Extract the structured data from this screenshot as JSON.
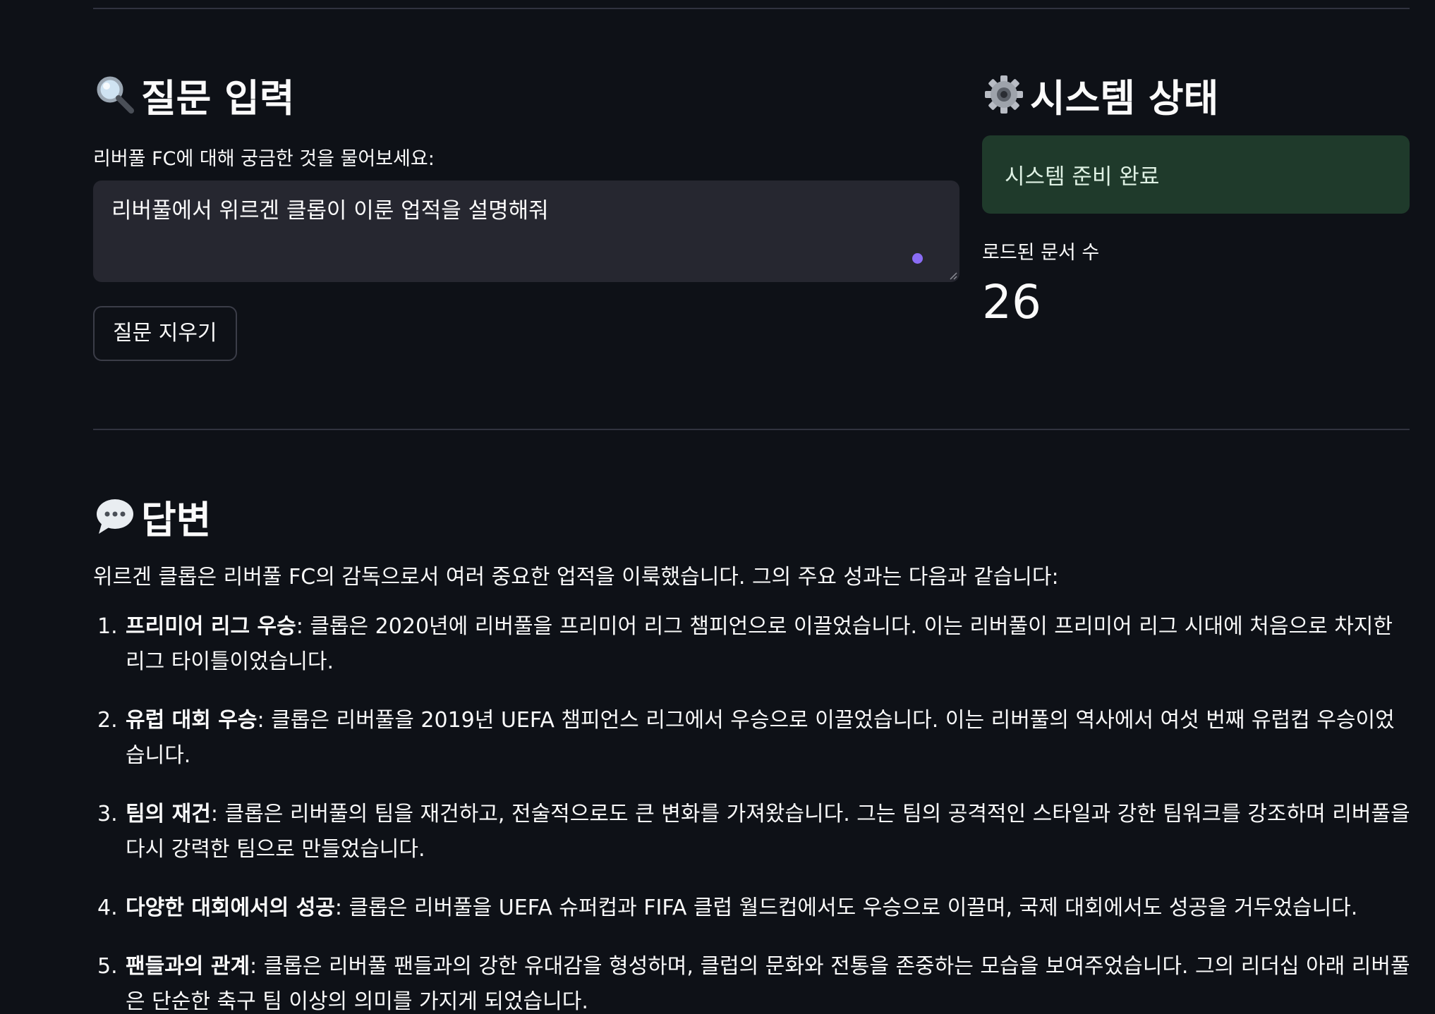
{
  "query_section": {
    "icon": "magnifier-icon",
    "title": "질문 입력",
    "input_label": "리버풀 FC에 대해 궁금한 것을 물어보세요:",
    "input_value": "리버풀에서 위르겐 클롭이 이룬 업적을 설명해줘",
    "clear_button_label": "질문 지우기"
  },
  "system_section": {
    "icon": "gear-icon",
    "title": "시스템 상태",
    "status_message": "시스템 준비 완료",
    "metric_label": "로드된 문서 수",
    "metric_value": "26"
  },
  "answer_section": {
    "icon": "speech-bubble-icon",
    "title": "답변",
    "intro": "위르겐 클롭은 리버풀 FC의 감독으로서 여러 중요한 업적을 이룩했습니다. 그의 주요 성과는 다음과 같습니다:",
    "items": [
      {
        "num": "1.",
        "heading": "프리미어 리그 우승",
        "text": ": 클롭은 2020년에 리버풀을 프리미어 리그 챔피언으로 이끌었습니다. 이는 리버풀이 프리미어 리그 시대에 처음으로 차지한 리그 타이틀이었습니다."
      },
      {
        "num": "2.",
        "heading": "유럽 대회 우승",
        "text": ": 클롭은 리버풀을 2019년 UEFA 챔피언스 리그에서 우승으로 이끌었습니다. 이는 리버풀의 역사에서 여섯 번째 유럽컵 우승이었습니다."
      },
      {
        "num": "3.",
        "heading": "팀의 재건",
        "text": ": 클롭은 리버풀의 팀을 재건하고, 전술적으로도 큰 변화를 가져왔습니다. 그는 팀의 공격적인 스타일과 강한 팀워크를 강조하며 리버풀을 다시 강력한 팀으로 만들었습니다."
      },
      {
        "num": "4.",
        "heading": "다양한 대회에서의 성공",
        "text": ": 클롭은 리버풀을 UEFA 슈퍼컵과 FIFA 클럽 월드컵에서도 우승으로 이끌며, 국제 대회에서도 성공을 거두었습니다."
      },
      {
        "num": "5.",
        "heading": "팬들과의 관계",
        "text": ": 클롭은 리버풀 팬들과의 강한 유대감을 형성하며, 클럽의 문화와 전통을 존중하는 모습을 보여주었습니다. 그의 리더십 아래 리버풀은 단순한 축구 팀 이상의 의미를 가지게 되었습니다."
      }
    ]
  },
  "colors": {
    "background": "#0e1117",
    "input_bg": "#262730",
    "success_bg": "#1f3a2b",
    "accent_dot": "#8a6cf5"
  }
}
